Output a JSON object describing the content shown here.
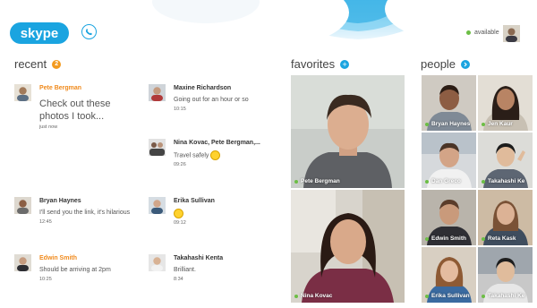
{
  "app": {
    "logo_text": "skype"
  },
  "header": {
    "status_label": "available"
  },
  "recent": {
    "title": "recent",
    "count": "2",
    "items": [
      {
        "name": "Pete Bergman",
        "message": "Check out these photos I took...",
        "time": "just now",
        "name_color": "orange"
      },
      {
        "name": "Maxine Richardson",
        "message": "Going out for an hour or so",
        "time": "10:15"
      },
      {
        "name": "Nina Kovac, Pete Bergman,...",
        "message": "Travel safely",
        "time": "09:26"
      },
      {
        "name": "Bryan Haynes",
        "message": "I'll send you the link, it's hilarious",
        "time": "12:45"
      },
      {
        "name": "Erika Sullivan",
        "message": "",
        "time": "09:12"
      },
      {
        "name": "Edwin Smith",
        "message": "Should be arriving at 2pm",
        "time": "10:25",
        "name_color": "orange"
      },
      {
        "name": "Takahashi Kenta",
        "message": "Brilliant.",
        "time": "8:34"
      }
    ]
  },
  "favorites": {
    "title": "favorites",
    "tiles": [
      {
        "name": "Pete Bergman"
      },
      {
        "name": "Nina Kovac"
      }
    ]
  },
  "people": {
    "title": "people",
    "tiles": [
      {
        "name": "Bryan Haynes"
      },
      {
        "name": "Jen Kaur"
      },
      {
        "name": "Dan Greco"
      },
      {
        "name": "Takahashi Ke"
      },
      {
        "name": "Edwin Smith"
      },
      {
        "name": "Reta Kask"
      },
      {
        "name": "Erika Sullivan"
      },
      {
        "name": "Takahashi Ke"
      }
    ]
  },
  "colors": {
    "accent": "#1aa4e0",
    "badge": "#f39a1e",
    "online": "#6cbe45",
    "highlight_name": "#f08a1c"
  }
}
